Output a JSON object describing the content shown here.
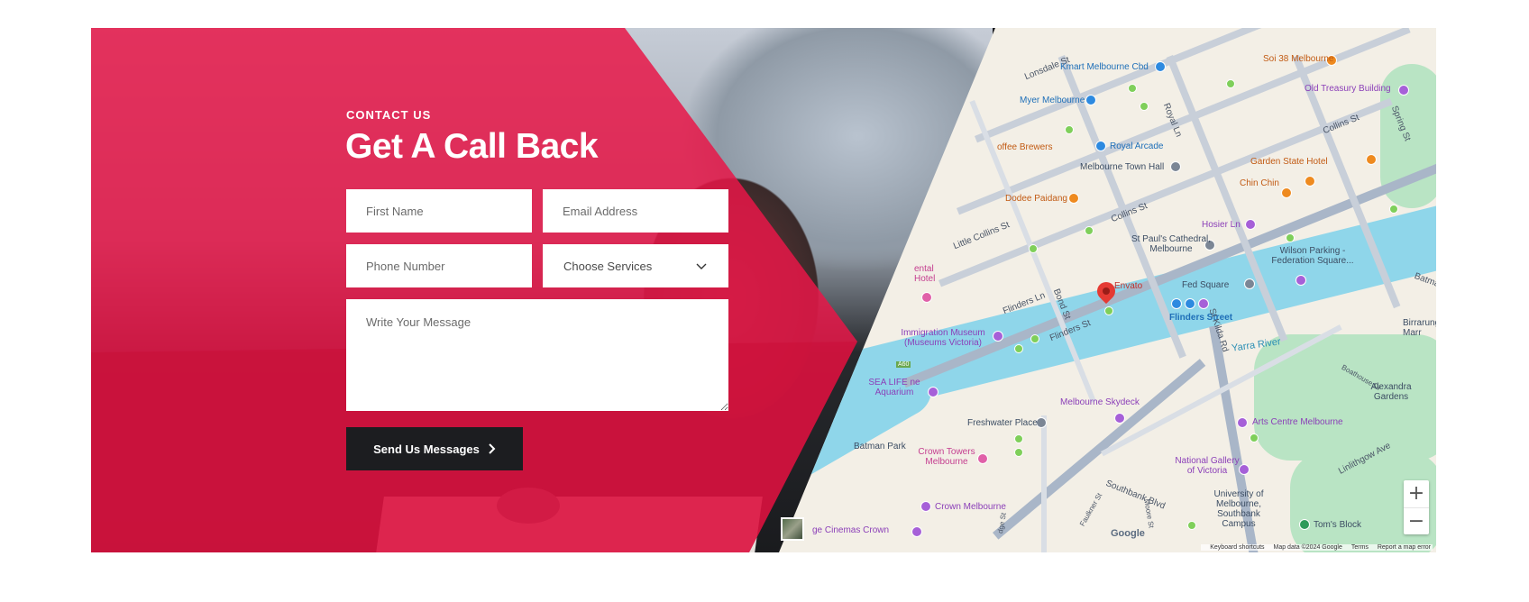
{
  "contact": {
    "eyebrow": "CONTACT US",
    "title": "Get A Call Back",
    "first_name_placeholder": "First Name",
    "email_placeholder": "Email Address",
    "phone_placeholder": "Phone Number",
    "services_selected": "Choose Services",
    "message_placeholder": "Write Your Message",
    "submit_label": "Send Us Messages",
    "accent_color": "#e81648",
    "button_color": "#1c1d20"
  },
  "map": {
    "labels": {
      "lonsdale": "Lonsdale St",
      "kmart": "Kmart Melbourne Cbd",
      "soi38": "Soi 38 Melbourne",
      "treasury": "Old Treasury Building",
      "myer": "Myer Melbourne",
      "royal_ln": "Royal Ln",
      "collins_st_top": "Collins St",
      "spring_st": "Spring St",
      "royal_arcade": "Royal Arcade",
      "coffee": "offee Brewers",
      "town_hall": "Melbourne Town Hall",
      "garden_state": "Garden State Hotel",
      "chin_chin": "Chin Chin",
      "dodee": "Dodee Paidang",
      "collins_st_mid": "Collins St",
      "little_collins": "Little Collins St",
      "hosier": "Hosier Ln",
      "st_pauls": "St Paul's Cathedral, Melbourne",
      "wilson": "Wilson Parking - Federation Square...",
      "batman": "Batman",
      "rental_hotel": "ental Hotel",
      "fed_square": "Fed Square",
      "flinders_ln": "Flinders Ln",
      "bond_st": "Bond St",
      "envato": "Envato",
      "flinders_street": "Flinders Street",
      "flinders_st": "Flinders St",
      "birrarung": "Birrarung Marr",
      "immigration": "Immigration Museum (Museums Victoria)",
      "st_kilda": "St Kilda Rd",
      "yarra": "Yarra River",
      "a60": "A60",
      "sealife": "SEA LIFE ne Aquarium",
      "boathouse": "Boathouse Dr",
      "alexandra": "Alexandra Gardens",
      "skydeck": "Melbourne Skydeck",
      "freshwater": "Freshwater Place",
      "arts_centre": "Arts Centre Melbourne",
      "batman_park": "Batman Park",
      "crown_towers": "Crown Towers Melbourne",
      "ngv": "National Gallery of Victoria",
      "linlithgow": "Linlithgow Ave",
      "southbank_blvd": "Southbank Blvd",
      "crown_melbourne": "Crown Melbourne",
      "uni": "University of Melbourne, Southbank Campus",
      "toms_block": "Tom's Block",
      "cinemas": "ge Cinemas Crown",
      "google": "Google",
      "faulkner": "Faulkner St",
      "moore": "Moore St",
      "bridge_st": "dge St"
    },
    "zoom_in": "+",
    "zoom_out": "−",
    "footer": {
      "shortcuts": "Keyboard shortcuts",
      "map_data": "Map data ©2024 Google",
      "terms": "Terms",
      "report": "Report a map error"
    },
    "colors": {
      "water": "#8fd6ea",
      "park": "#b9e4c4",
      "land": "#f3efe6",
      "pin": "#e53a33"
    }
  }
}
